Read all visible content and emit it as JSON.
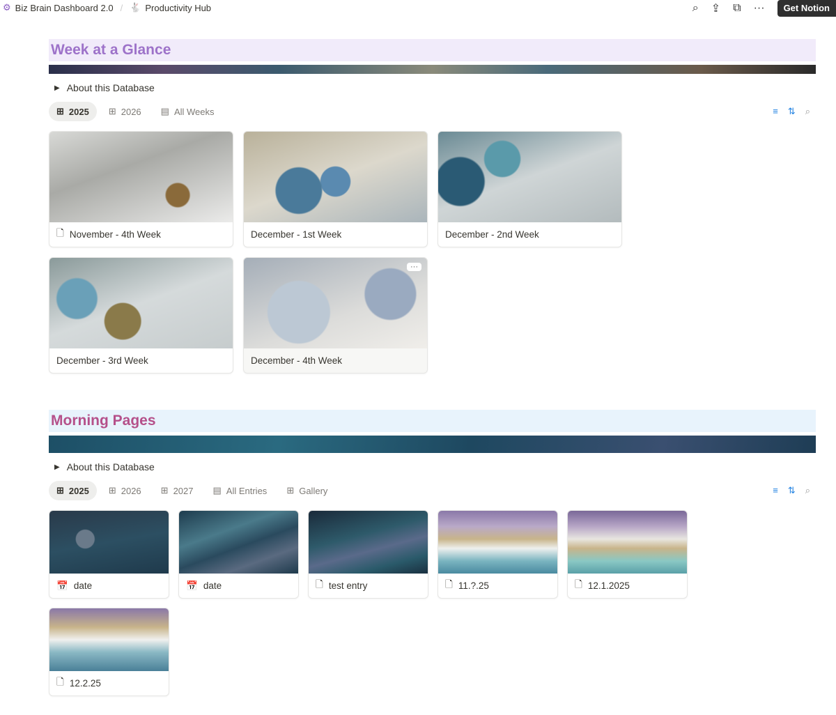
{
  "breadcrumb": [
    {
      "label": "Biz Brain Dashboard 2.0",
      "icon": "gears-icon"
    },
    {
      "label": "Productivity Hub",
      "icon": "rabbit-icon"
    }
  ],
  "topbar": {
    "get_button": "Get Notion"
  },
  "week": {
    "title": "Week at a Glance",
    "about": "About this Database",
    "tabs": [
      {
        "label": "2025"
      },
      {
        "label": "2026"
      },
      {
        "label": "All Weeks"
      }
    ],
    "cards": [
      {
        "label": "November - 4th Week",
        "icon": "page-icon"
      },
      {
        "label": "December - 1st Week"
      },
      {
        "label": "December - 2nd Week"
      },
      {
        "label": "December - 3rd Week"
      },
      {
        "label": "December - 4th Week",
        "more": "···"
      }
    ]
  },
  "morning": {
    "title": "Morning Pages",
    "about": "About this Database",
    "tabs": [
      {
        "label": "2025"
      },
      {
        "label": "2026"
      },
      {
        "label": "2027"
      },
      {
        "label": "All Entries"
      },
      {
        "label": "Gallery"
      }
    ],
    "cards": [
      {
        "label": "date",
        "icon": "calendar-icon",
        "cal": "17"
      },
      {
        "label": "date",
        "icon": "calendar-icon",
        "cal": "17"
      },
      {
        "label": "test entry",
        "icon": "page-icon"
      },
      {
        "label": "11.?.25",
        "icon": "page-icon"
      },
      {
        "label": "12.1.2025",
        "icon": "page-icon"
      },
      {
        "label": "12.2.25",
        "icon": "page-icon"
      }
    ]
  },
  "colors": {
    "week_title": "#9d72c9",
    "week_band": "#f1ebfa",
    "morning_title": "#b5508a",
    "morning_band": "#e8f3fc",
    "accent": "#2383e2"
  }
}
